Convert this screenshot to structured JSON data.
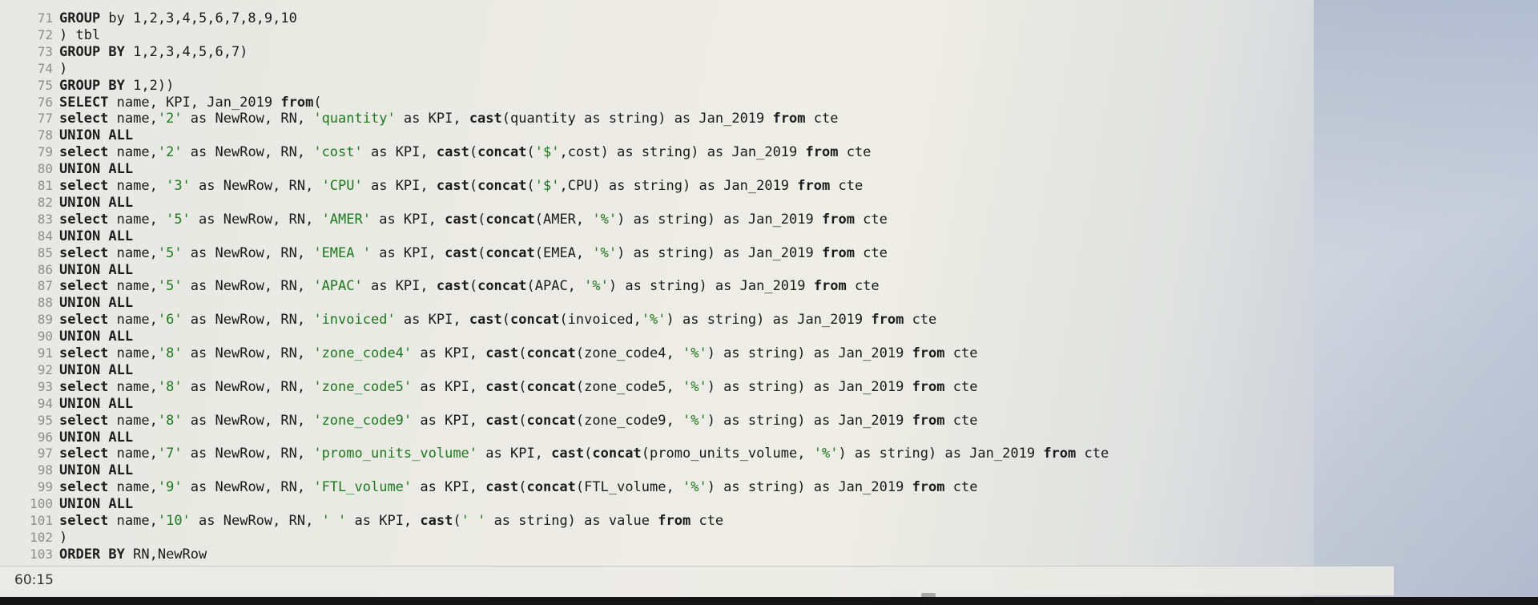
{
  "editor": {
    "lines": [
      {
        "n": "71",
        "tokens": [
          [
            "kw",
            "GROUP"
          ],
          [
            "t",
            " by 1,2,3,4,5,6,7,8,9,10"
          ]
        ]
      },
      {
        "n": "72",
        "tokens": [
          [
            "t",
            ") tbl"
          ]
        ]
      },
      {
        "n": "73",
        "tokens": [
          [
            "kw",
            "GROUP BY"
          ],
          [
            "t",
            " 1,2,3,4,5,6,7)"
          ]
        ]
      },
      {
        "n": "74",
        "tokens": [
          [
            "t",
            ")"
          ]
        ]
      },
      {
        "n": "75",
        "tokens": [
          [
            "kw",
            "GROUP BY"
          ],
          [
            "t",
            " 1,2))"
          ]
        ]
      },
      {
        "n": "76",
        "tokens": [
          [
            "kw",
            "SELECT"
          ],
          [
            "t",
            " name, KPI, Jan_2019 "
          ],
          [
            "kw",
            "from"
          ],
          [
            "t",
            "("
          ]
        ]
      },
      {
        "n": "77",
        "tokens": [
          [
            "kw",
            "select"
          ],
          [
            "t",
            " name,"
          ],
          [
            "str",
            "'2'"
          ],
          [
            "t",
            " as NewRow, RN, "
          ],
          [
            "str",
            "'quantity'"
          ],
          [
            "t",
            " as KPI, "
          ],
          [
            "kw",
            "cast"
          ],
          [
            "t",
            "(quantity as string) as Jan_2019 "
          ],
          [
            "kw",
            "from"
          ],
          [
            "t",
            " cte"
          ]
        ]
      },
      {
        "n": "78",
        "tokens": [
          [
            "kw",
            "UNION ALL"
          ]
        ]
      },
      {
        "n": "79",
        "tokens": [
          [
            "kw",
            "select"
          ],
          [
            "t",
            " name,"
          ],
          [
            "str",
            "'2'"
          ],
          [
            "t",
            " as NewRow, RN, "
          ],
          [
            "str",
            "'cost'"
          ],
          [
            "t",
            " as KPI, "
          ],
          [
            "kw",
            "cast"
          ],
          [
            "t",
            "("
          ],
          [
            "kw",
            "concat"
          ],
          [
            "t",
            "("
          ],
          [
            "str",
            "'$'"
          ],
          [
            "t",
            ",cost) as string) as Jan_2019 "
          ],
          [
            "kw",
            "from"
          ],
          [
            "t",
            " cte"
          ]
        ]
      },
      {
        "n": "80",
        "tokens": [
          [
            "kw",
            "UNION ALL"
          ]
        ]
      },
      {
        "n": "81",
        "tokens": [
          [
            "kw",
            "select"
          ],
          [
            "t",
            " name, "
          ],
          [
            "str",
            "'3'"
          ],
          [
            "t",
            " as NewRow, RN, "
          ],
          [
            "str",
            "'CPU'"
          ],
          [
            "t",
            " as KPI, "
          ],
          [
            "kw",
            "cast"
          ],
          [
            "t",
            "("
          ],
          [
            "kw",
            "concat"
          ],
          [
            "t",
            "("
          ],
          [
            "str",
            "'$'"
          ],
          [
            "t",
            ",CPU) as string) as Jan_2019 "
          ],
          [
            "kw",
            "from"
          ],
          [
            "t",
            " cte"
          ]
        ]
      },
      {
        "n": "82",
        "tokens": [
          [
            "kw",
            "UNION ALL"
          ]
        ]
      },
      {
        "n": "83",
        "tokens": [
          [
            "kw",
            "select"
          ],
          [
            "t",
            " name, "
          ],
          [
            "str",
            "'5'"
          ],
          [
            "t",
            " as NewRow, RN, "
          ],
          [
            "str",
            "'AMER'"
          ],
          [
            "t",
            " as KPI, "
          ],
          [
            "kw",
            "cast"
          ],
          [
            "t",
            "("
          ],
          [
            "kw",
            "concat"
          ],
          [
            "t",
            "(AMER, "
          ],
          [
            "str",
            "'%'"
          ],
          [
            "t",
            ") as string) as Jan_2019 "
          ],
          [
            "kw",
            "from"
          ],
          [
            "t",
            " cte"
          ]
        ]
      },
      {
        "n": "84",
        "tokens": [
          [
            "kw",
            "UNION ALL"
          ]
        ]
      },
      {
        "n": "85",
        "tokens": [
          [
            "kw",
            "select"
          ],
          [
            "t",
            " name,"
          ],
          [
            "str",
            "'5'"
          ],
          [
            "t",
            " as NewRow, RN, "
          ],
          [
            "str",
            "'EMEA '"
          ],
          [
            "t",
            " as KPI, "
          ],
          [
            "kw",
            "cast"
          ],
          [
            "t",
            "("
          ],
          [
            "kw",
            "concat"
          ],
          [
            "t",
            "(EMEA, "
          ],
          [
            "str",
            "'%'"
          ],
          [
            "t",
            ") as string) as Jan_2019 "
          ],
          [
            "kw",
            "from"
          ],
          [
            "t",
            " cte"
          ]
        ]
      },
      {
        "n": "86",
        "tokens": [
          [
            "kw",
            "UNION ALL"
          ]
        ]
      },
      {
        "n": "87",
        "tokens": [
          [
            "kw",
            "select"
          ],
          [
            "t",
            " name,"
          ],
          [
            "str",
            "'5'"
          ],
          [
            "t",
            " as NewRow, RN, "
          ],
          [
            "str",
            "'APAC'"
          ],
          [
            "t",
            " as KPI, "
          ],
          [
            "kw",
            "cast"
          ],
          [
            "t",
            "("
          ],
          [
            "kw",
            "concat"
          ],
          [
            "t",
            "(APAC, "
          ],
          [
            "str",
            "'%'"
          ],
          [
            "t",
            ") as string) as Jan_2019 "
          ],
          [
            "kw",
            "from"
          ],
          [
            "t",
            " cte"
          ]
        ]
      },
      {
        "n": "88",
        "tokens": [
          [
            "kw",
            "UNION ALL"
          ]
        ]
      },
      {
        "n": "89",
        "tokens": [
          [
            "kw",
            "select"
          ],
          [
            "t",
            " name,"
          ],
          [
            "str",
            "'6'"
          ],
          [
            "t",
            " as NewRow, RN, "
          ],
          [
            "str",
            "'invoiced'"
          ],
          [
            "t",
            " as KPI, "
          ],
          [
            "kw",
            "cast"
          ],
          [
            "t",
            "("
          ],
          [
            "kw",
            "concat"
          ],
          [
            "t",
            "(invoiced,"
          ],
          [
            "str",
            "'%'"
          ],
          [
            "t",
            ") as string) as Jan_2019 "
          ],
          [
            "kw",
            "from"
          ],
          [
            "t",
            " cte"
          ]
        ]
      },
      {
        "n": "90",
        "tokens": [
          [
            "kw",
            "UNION ALL"
          ]
        ]
      },
      {
        "n": "91",
        "tokens": [
          [
            "kw",
            "select"
          ],
          [
            "t",
            " name,"
          ],
          [
            "str",
            "'8'"
          ],
          [
            "t",
            " as NewRow, RN, "
          ],
          [
            "str",
            "'zone_code4'"
          ],
          [
            "t",
            " as KPI, "
          ],
          [
            "kw",
            "cast"
          ],
          [
            "t",
            "("
          ],
          [
            "kw",
            "concat"
          ],
          [
            "t",
            "(zone_code4, "
          ],
          [
            "str",
            "'%'"
          ],
          [
            "t",
            ") as string) as Jan_2019 "
          ],
          [
            "kw",
            "from"
          ],
          [
            "t",
            " cte"
          ]
        ]
      },
      {
        "n": "92",
        "tokens": [
          [
            "kw",
            "UNION ALL"
          ]
        ]
      },
      {
        "n": "93",
        "tokens": [
          [
            "kw",
            "select"
          ],
          [
            "t",
            " name,"
          ],
          [
            "str",
            "'8'"
          ],
          [
            "t",
            " as NewRow, RN, "
          ],
          [
            "str",
            "'zone_code5'"
          ],
          [
            "t",
            " as KPI, "
          ],
          [
            "kw",
            "cast"
          ],
          [
            "t",
            "("
          ],
          [
            "kw",
            "concat"
          ],
          [
            "t",
            "(zone_code5, "
          ],
          [
            "str",
            "'%'"
          ],
          [
            "t",
            ") as string) as Jan_2019 "
          ],
          [
            "kw",
            "from"
          ],
          [
            "t",
            " cte"
          ]
        ]
      },
      {
        "n": "94",
        "tokens": [
          [
            "kw",
            "UNION ALL"
          ]
        ]
      },
      {
        "n": "95",
        "tokens": [
          [
            "kw",
            "select"
          ],
          [
            "t",
            " name,"
          ],
          [
            "str",
            "'8'"
          ],
          [
            "t",
            " as NewRow, RN, "
          ],
          [
            "str",
            "'zone_code9'"
          ],
          [
            "t",
            " as KPI, "
          ],
          [
            "kw",
            "cast"
          ],
          [
            "t",
            "("
          ],
          [
            "kw",
            "concat"
          ],
          [
            "t",
            "(zone_code9, "
          ],
          [
            "str",
            "'%'"
          ],
          [
            "t",
            ") as string) as Jan_2019 "
          ],
          [
            "kw",
            "from"
          ],
          [
            "t",
            " cte"
          ]
        ]
      },
      {
        "n": "96",
        "tokens": [
          [
            "kw",
            "UNION ALL"
          ]
        ]
      },
      {
        "n": "97",
        "tokens": [
          [
            "kw",
            "select"
          ],
          [
            "t",
            " name,"
          ],
          [
            "str",
            "'7'"
          ],
          [
            "t",
            " as NewRow, RN, "
          ],
          [
            "str",
            "'promo_units_volume'"
          ],
          [
            "t",
            " as KPI, "
          ],
          [
            "kw",
            "cast"
          ],
          [
            "t",
            "("
          ],
          [
            "kw",
            "concat"
          ],
          [
            "t",
            "(promo_units_volume, "
          ],
          [
            "str",
            "'%'"
          ],
          [
            "t",
            ") as string) as Jan_2019 "
          ],
          [
            "kw",
            "from"
          ],
          [
            "t",
            " cte"
          ]
        ]
      },
      {
        "n": "98",
        "tokens": [
          [
            "kw",
            "UNION ALL"
          ]
        ]
      },
      {
        "n": "99",
        "tokens": [
          [
            "kw",
            "select"
          ],
          [
            "t",
            " name,"
          ],
          [
            "str",
            "'9'"
          ],
          [
            "t",
            " as NewRow, RN, "
          ],
          [
            "str",
            "'FTL_volume'"
          ],
          [
            "t",
            " as KPI, "
          ],
          [
            "kw",
            "cast"
          ],
          [
            "t",
            "("
          ],
          [
            "kw",
            "concat"
          ],
          [
            "t",
            "(FTL_volume, "
          ],
          [
            "str",
            "'%'"
          ],
          [
            "t",
            ") as string) as Jan_2019 "
          ],
          [
            "kw",
            "from"
          ],
          [
            "t",
            " cte"
          ]
        ]
      },
      {
        "n": "100",
        "tokens": [
          [
            "kw",
            "UNION ALL"
          ]
        ]
      },
      {
        "n": "101",
        "tokens": [
          [
            "kw",
            "select"
          ],
          [
            "t",
            " name,"
          ],
          [
            "str",
            "'10'"
          ],
          [
            "t",
            " as NewRow, RN, "
          ],
          [
            "str",
            "' '"
          ],
          [
            "t",
            " as KPI, "
          ],
          [
            "kw",
            "cast"
          ],
          [
            "t",
            "("
          ],
          [
            "str",
            "' '"
          ],
          [
            "t",
            " as string) as value "
          ],
          [
            "kw",
            "from"
          ],
          [
            "t",
            " cte"
          ]
        ]
      },
      {
        "n": "102",
        "tokens": [
          [
            "t",
            ")"
          ]
        ]
      },
      {
        "n": "103",
        "tokens": [
          [
            "kw",
            "ORDER BY"
          ],
          [
            "t",
            " RN,NewRow"
          ]
        ]
      }
    ]
  },
  "status_bar": {
    "cursor_position": "60:15"
  },
  "colors": {
    "keyword": "#1c1c1c",
    "string": "#1c7a1c",
    "gutter": "#8d8d8d"
  }
}
